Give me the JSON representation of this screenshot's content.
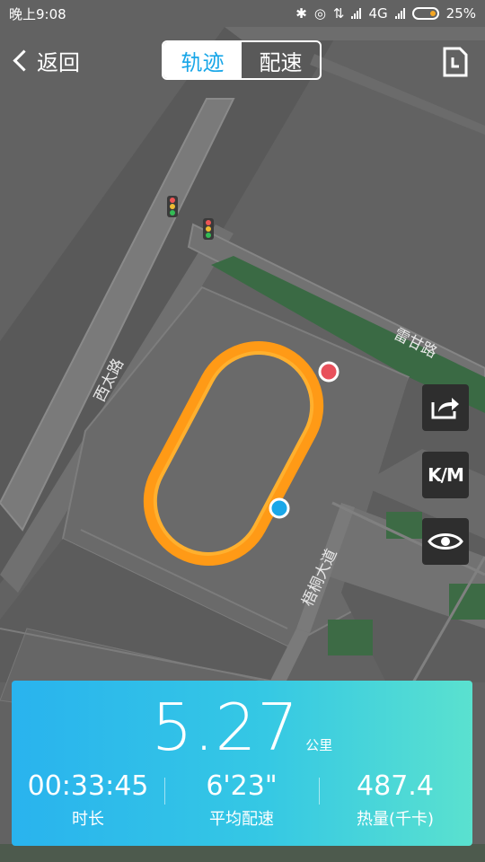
{
  "status_bar": {
    "time": "晚上9:08",
    "network": "4G",
    "battery": "25%"
  },
  "header": {
    "back_label": "返回",
    "tabs": [
      {
        "label": "轨迹",
        "active": true
      },
      {
        "label": "配速",
        "active": false
      }
    ]
  },
  "map": {
    "road_labels": [
      "西太路",
      "雷甘路",
      "梧桐大道"
    ],
    "start_marker_color": "#1aa7e8",
    "end_marker_color": "#e8505b",
    "track_color": "#ff9a16"
  },
  "side_buttons": {
    "share_icon": "share-icon",
    "km_label": "K/M",
    "eye_icon": "eye-icon"
  },
  "stats": {
    "distance": "5.27",
    "distance_unit": "公里",
    "duration": "00:33:45",
    "duration_label": "时长",
    "pace": "6'23\"",
    "pace_label": "平均配速",
    "calories": "487.4",
    "calories_label": "热量(千卡)"
  }
}
